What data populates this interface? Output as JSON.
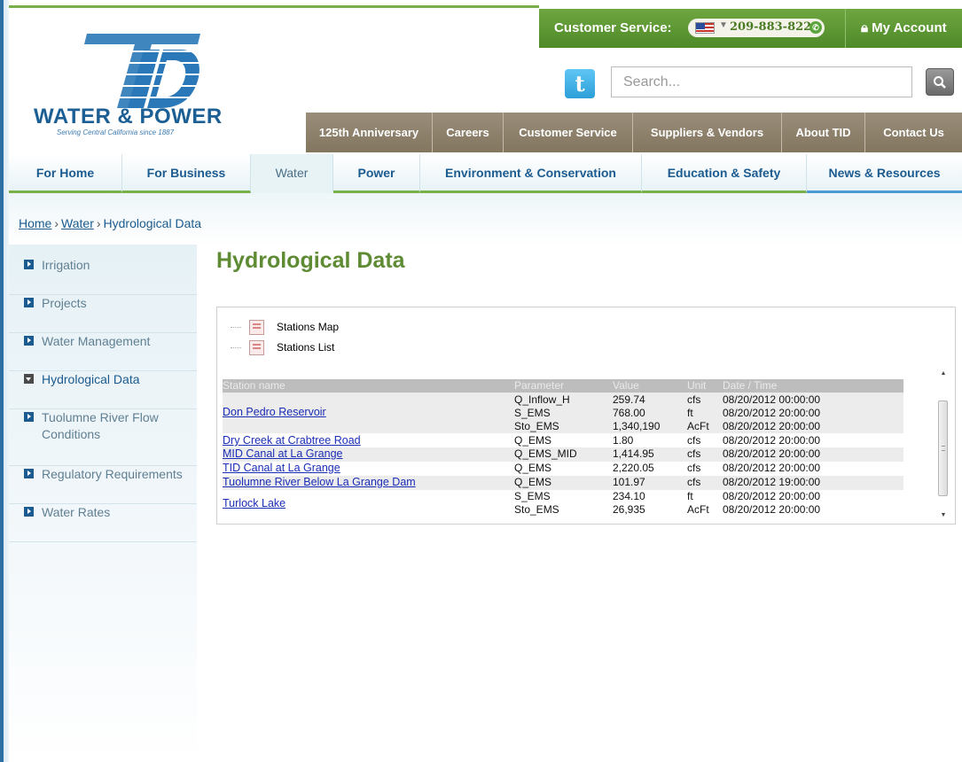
{
  "header": {
    "logo_title": "WATER & POWER",
    "logo_tagline": "Serving Central California since 1887",
    "customer_service_label": "Customer Service:",
    "phone": "209-883-8222",
    "account_label": "My Account",
    "search_placeholder": "Search..."
  },
  "utility_nav": [
    "125th Anniversary",
    "Careers",
    "Customer Service",
    "Suppliers & Vendors",
    "About TID",
    "Contact Us"
  ],
  "main_nav": [
    "For Home",
    "For Business",
    "Water",
    "Power",
    "Environment & Conservation",
    "Education & Safety",
    "News & Resources"
  ],
  "breadcrumb": {
    "home": "Home",
    "section": "Water",
    "current": "Hydrological Data",
    "separator": "›"
  },
  "sidebar": {
    "items": [
      {
        "label": "Irrigation"
      },
      {
        "label": "Projects"
      },
      {
        "label": "Water Management"
      },
      {
        "label": "Hydrological Data"
      },
      {
        "label": "Tuolumne River Flow Conditions"
      },
      {
        "label": "Regulatory Requirements"
      },
      {
        "label": "Water Rates"
      }
    ]
  },
  "page": {
    "title": "Hydrological Data"
  },
  "tree": {
    "stations_map": "Stations Map",
    "stations_list": "Stations List"
  },
  "table": {
    "headers": {
      "station": "Station name",
      "parameter": "Parameter",
      "value": "Value",
      "unit": "Unit",
      "datetime": "Date / Time"
    },
    "groups": [
      {
        "station": "Don Pedro Reservoir",
        "rows": [
          {
            "parameter": "Q_Inflow_H",
            "value": "259.74",
            "unit": "cfs",
            "datetime": "08/20/2012 00:00:00"
          },
          {
            "parameter": "S_EMS",
            "value": "768.00",
            "unit": "ft",
            "datetime": "08/20/2012 20:00:00"
          },
          {
            "parameter": "Sto_EMS",
            "value": "1,340,190",
            "unit": "AcFt",
            "datetime": "08/20/2012 20:00:00"
          }
        ]
      },
      {
        "station": "Dry Creek at Crabtree Road",
        "rows": [
          {
            "parameter": "Q_EMS",
            "value": "1.80",
            "unit": "cfs",
            "datetime": "08/20/2012 20:00:00"
          }
        ]
      },
      {
        "station": "MID Canal at La Grange",
        "rows": [
          {
            "parameter": "Q_EMS_MID",
            "value": "1,414.95",
            "unit": "cfs",
            "datetime": "08/20/2012 20:00:00"
          }
        ]
      },
      {
        "station": "TID Canal at La Grange",
        "rows": [
          {
            "parameter": "Q_EMS",
            "value": "2,220.05",
            "unit": "cfs",
            "datetime": "08/20/2012 20:00:00"
          }
        ]
      },
      {
        "station": "Tuolumne River Below La Grange Dam",
        "rows": [
          {
            "parameter": "Q_EMS",
            "value": "101.97",
            "unit": "cfs",
            "datetime": "08/20/2012 19:00:00"
          }
        ]
      },
      {
        "station": "Turlock Lake",
        "rows": [
          {
            "parameter": "S_EMS",
            "value": "234.10",
            "unit": "ft",
            "datetime": "08/20/2012 20:00:00"
          },
          {
            "parameter": "Sto_EMS",
            "value": "26,935",
            "unit": "AcFt",
            "datetime": "08/20/2012 20:00:00"
          }
        ]
      }
    ]
  },
  "colors": {
    "brand_green": "#5e8b33",
    "brand_blue": "#1b5b8f",
    "utility_bar": "#8c7f6c",
    "service_bar": "#5e9a33"
  }
}
